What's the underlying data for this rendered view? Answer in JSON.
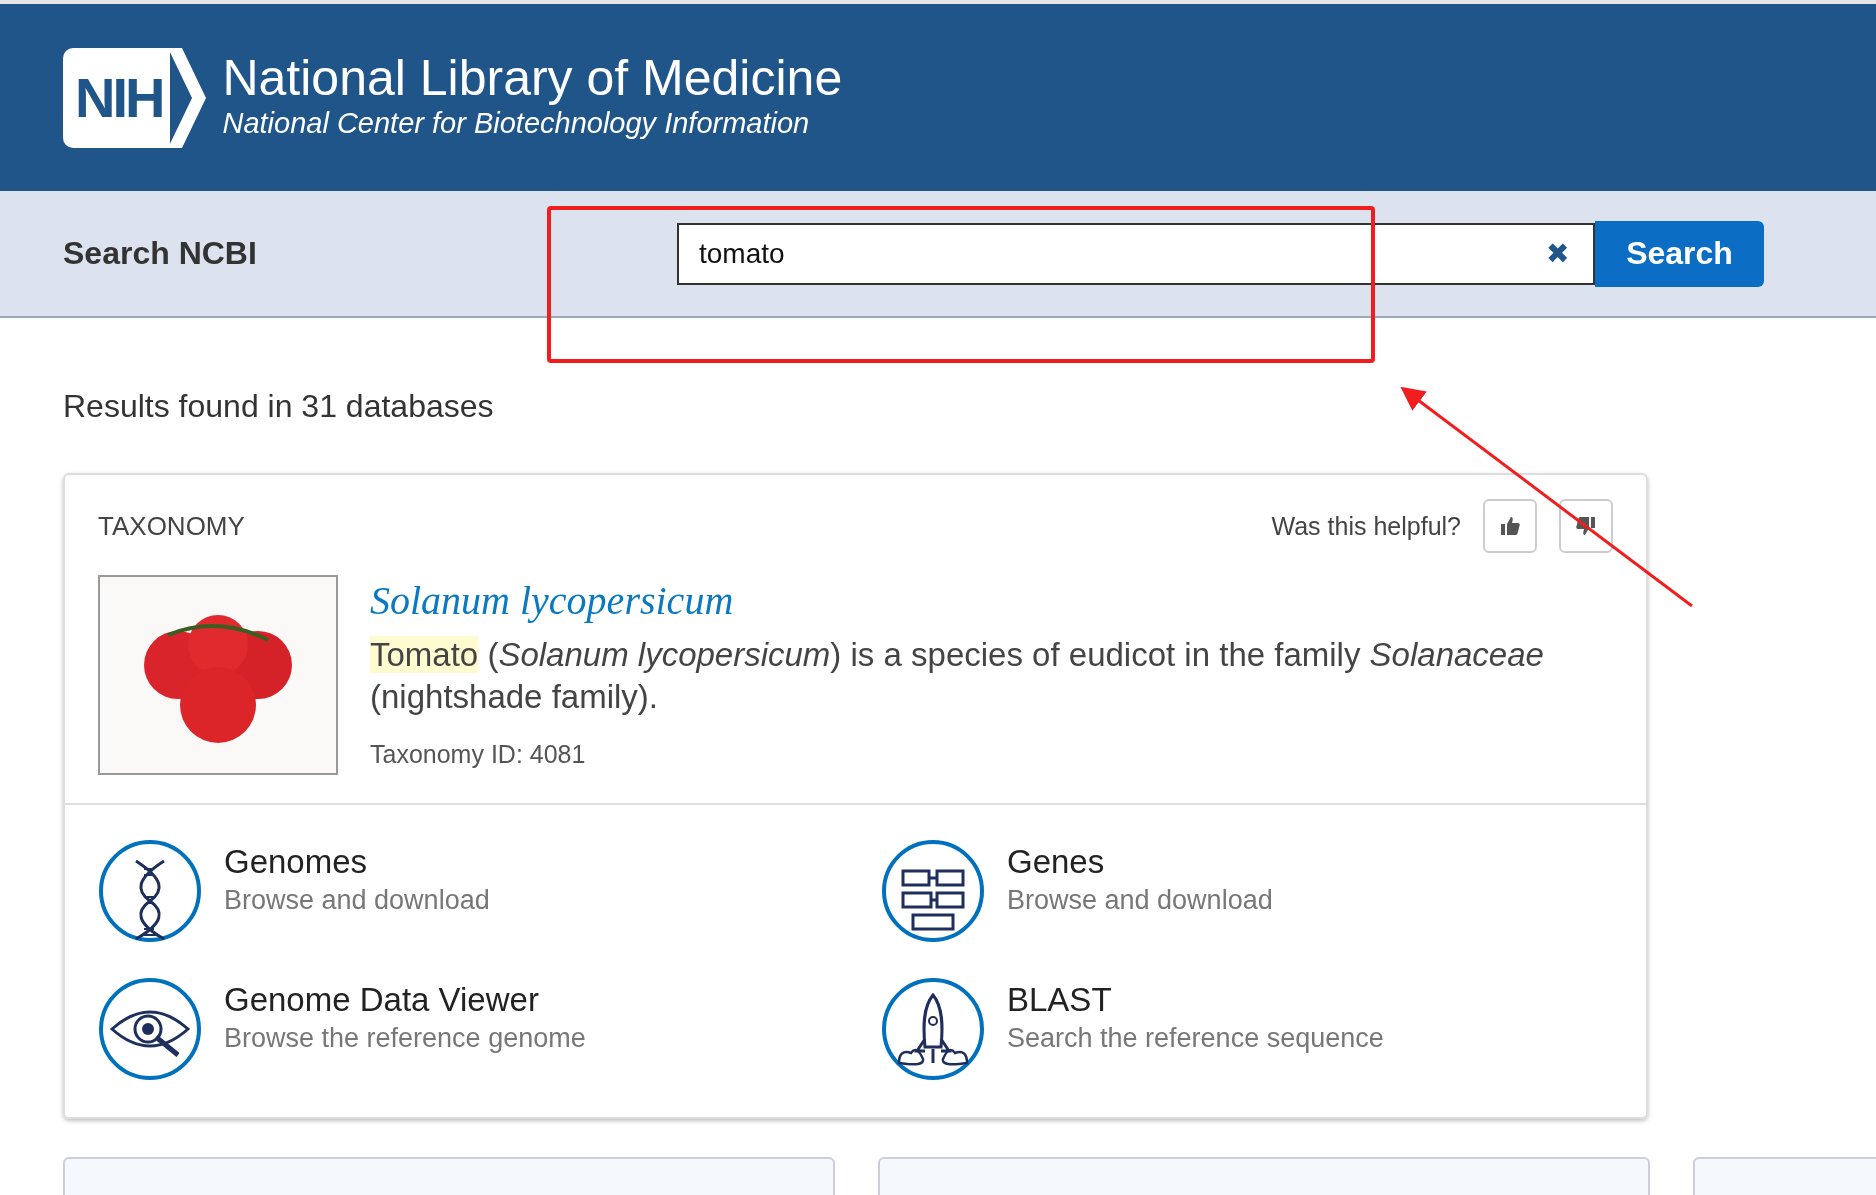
{
  "header": {
    "logo": "NIH",
    "title": "National Library of Medicine",
    "subtitle": "National Center for Biotechnology Information"
  },
  "search": {
    "label": "Search NCBI",
    "value": "tomato",
    "clear": "✖",
    "button": "Search"
  },
  "results_heading": "Results found in 31 databases",
  "result_card": {
    "category": "TAXONOMY",
    "feedback_prompt": "Was this helpful?",
    "title": "Solanum lycopersicum",
    "highlight": "Tomato",
    "description": " (*Solanum lycopersicum*) is a species of eudicot in the family *Solanaceae* (nightshade family).",
    "taxonomy_id": "Taxonomy ID: 4081",
    "links": [
      {
        "kind": "genomes",
        "title": "Genomes",
        "subtitle": "Browse and download"
      },
      {
        "kind": "genes",
        "title": "Genes",
        "subtitle": "Browse and download"
      },
      {
        "kind": "viewer",
        "title": "Genome Data Viewer",
        "subtitle": "Browse the reference genome"
      },
      {
        "kind": "blast",
        "title": "BLAST",
        "subtitle": "Search the reference sequence"
      }
    ]
  }
}
